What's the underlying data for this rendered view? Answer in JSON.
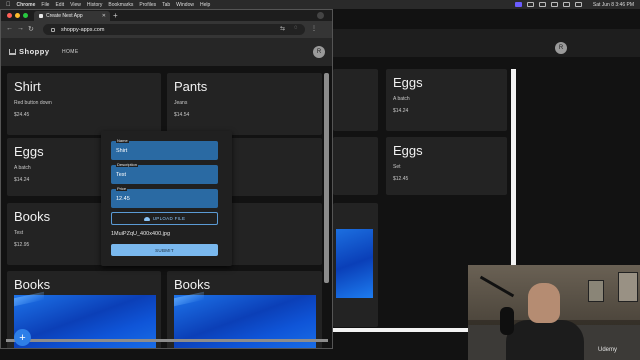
{
  "menubar": {
    "app": "Chrome",
    "items": [
      "File",
      "Edit",
      "View",
      "History",
      "Bookmarks",
      "Profiles",
      "Tab",
      "Window",
      "Help"
    ],
    "clock": "Sat Jun 8  3:46 PM"
  },
  "browser": {
    "tab_title": "Create Next App",
    "url": "shoppy-apps.com"
  },
  "app": {
    "logo": "Shoppy",
    "nav_home": "HOME",
    "avatar_letter": "R"
  },
  "cards": [
    {
      "title": "Shirt",
      "description": "Red button down",
      "price": "$24.45"
    },
    {
      "title": "Pants",
      "description": "Jeans",
      "price": "$14.54"
    },
    {
      "title": "Eggs",
      "description": "A batch",
      "price": "$14.24"
    },
    {
      "title": "Books",
      "description": "Test",
      "price": "$12.95"
    },
    {
      "title": "Books"
    },
    {
      "title": "Books"
    }
  ],
  "background_cards": [
    {
      "title": "Eggs",
      "description": "A batch",
      "price": "$14.24"
    },
    {
      "title": "Eggs",
      "description": "Set",
      "price": "$12.45"
    }
  ],
  "modal": {
    "name_label": "Name",
    "name_value": "Shirt",
    "description_label": "Description",
    "description_value": "Test",
    "price_label": "Price",
    "price_value": "12.45",
    "upload_label": "UPLOAD FILE",
    "file_name": "1MuiPZqU_400x400.jpg",
    "submit_label": "SUBMIT"
  },
  "fab_label": "+",
  "webcam": {
    "watermark": "Udemy"
  }
}
